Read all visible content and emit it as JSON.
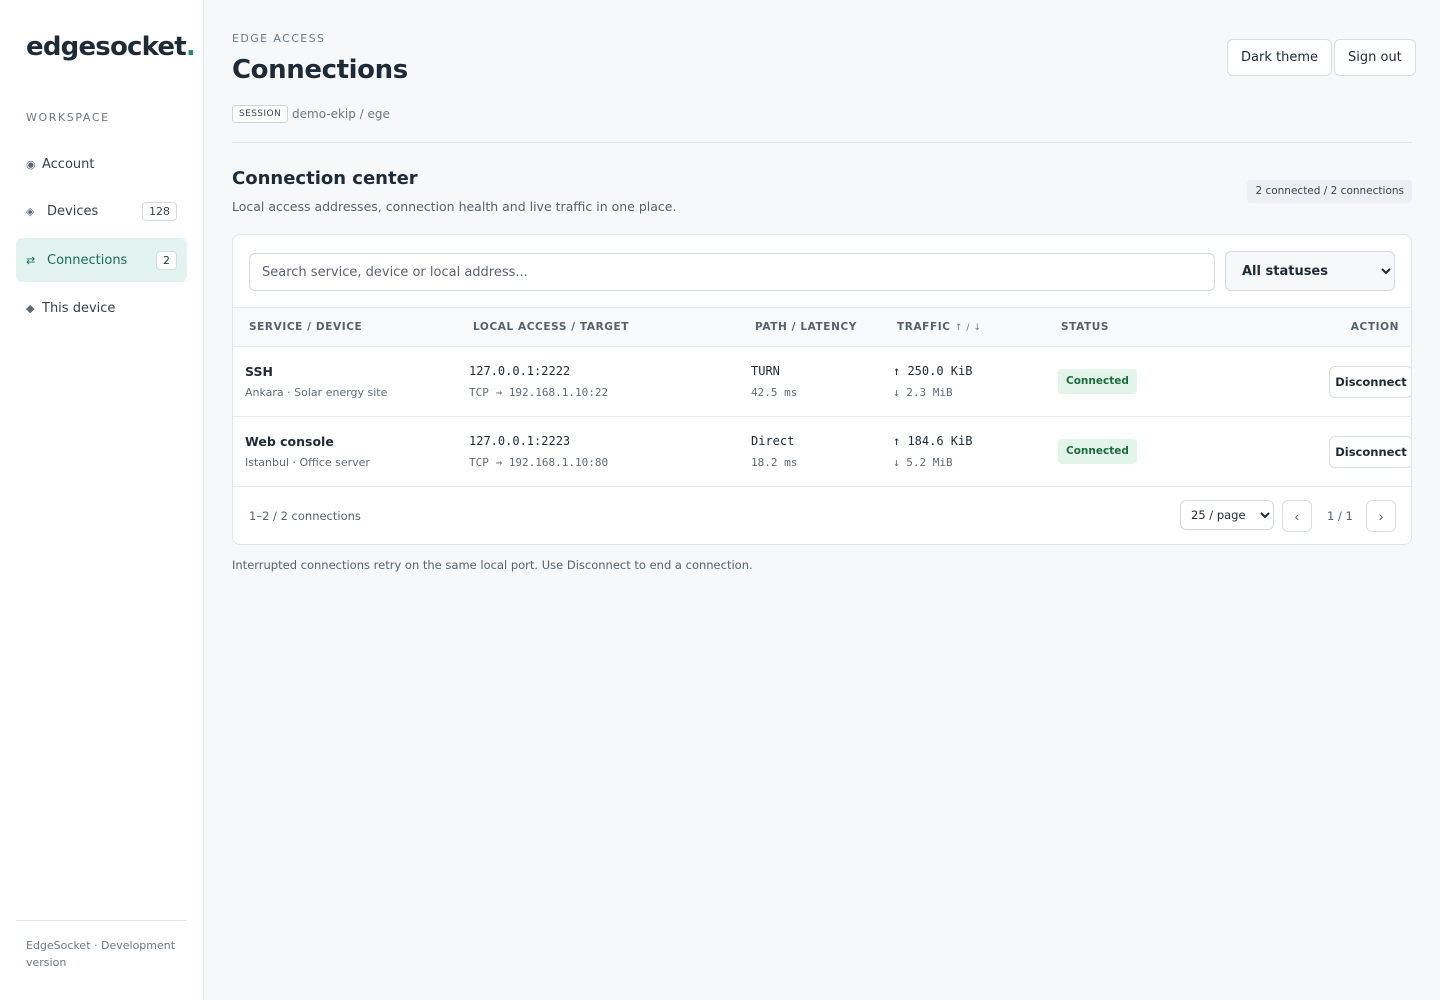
{
  "sidebar": {
    "brand": "edgesocket",
    "brand_dot": ".",
    "section_label": "WORKSPACE",
    "items": [
      {
        "icon": "◉",
        "label": "Account",
        "badge": ""
      },
      {
        "icon": "◈",
        "label": "Devices",
        "badge": "128"
      },
      {
        "icon": "⇄",
        "label": "Connections",
        "badge": "2"
      },
      {
        "icon": "◆",
        "label": "This device",
        "badge": ""
      }
    ],
    "footer": "EdgeSocket · Development version"
  },
  "header": {
    "eyebrow": "EDGE ACCESS",
    "title": "Connections",
    "session_tag": "SESSION",
    "session_value": "demo-ekip / ege",
    "dark_theme_label": "Dark theme",
    "sign_out_label": "Sign out"
  },
  "section": {
    "title": "Connection center",
    "subtitle": "Local access addresses, connection health and live traffic in one place.",
    "count_pill": "2 connected / 2 connections"
  },
  "filters": {
    "search_placeholder": "Search service, device or local address...",
    "status_selected": "All statuses"
  },
  "table": {
    "columns": {
      "service": "SERVICE / DEVICE",
      "local": "LOCAL ACCESS / TARGET",
      "path": "PATH / LATENCY",
      "traffic": "TRAFFIC",
      "traffic_sort": "↑ / ↓",
      "status": "STATUS",
      "action": "ACTION"
    },
    "rows": [
      {
        "service": "SSH",
        "device": "Ankara · Solar energy site",
        "local": "127.0.0.1:2222",
        "target": "TCP → 192.168.1.10:22",
        "path": "TURN",
        "latency": "42.5 ms",
        "up": "↑ 250.0 KiB",
        "down": "↓ 2.3 MiB",
        "status": "Connected",
        "action": "Disconnect"
      },
      {
        "service": "Web console",
        "device": "Istanbul · Office server",
        "local": "127.0.0.1:2223",
        "target": "TCP → 192.168.1.10:80",
        "path": "Direct",
        "latency": "18.2 ms",
        "up": "↑ 184.6 KiB",
        "down": "↓ 5.2 MiB",
        "status": "Connected",
        "action": "Disconnect"
      }
    ]
  },
  "pagination": {
    "count_text": "1–2 / 2 connections",
    "per_page": "25 / page",
    "prev": "‹",
    "next": "›",
    "page_text": "1 / 1"
  },
  "note": "Interrupted connections retry on the same local port. Use Disconnect to end a connection.",
  "colors": {
    "accent": "#1f8a78",
    "active_nav_bg": "#e3f3ef",
    "connected_badge_bg": "#e3f4ea",
    "connected_badge_text": "#1c6b3c"
  }
}
